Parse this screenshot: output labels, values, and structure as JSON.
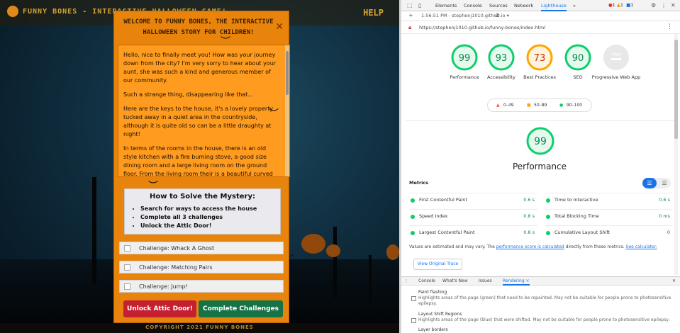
{
  "game": {
    "brand": "FUNNY BONES - INTERACTIVE HALLOWEEN GAME!",
    "help": "HELP",
    "footer": "COPYRIGHT 2021 FUNNY BONES",
    "modal": {
      "title": "WELCOME TO FUNNY BONES, THE INTERACTIVE HALLOWEEN STORY FOR CHILDREN!",
      "close_icon": "close-icon",
      "story": [
        "Hello, nice to finally meet you! How was your journey down from the city? I'm very sorry to hear about your aunt, she was such a kind and generous member of our community.",
        "Such a strange thing, disappearing like that...",
        "Here are the keys to the house, it's a lovely property tucked away in a quiet area in the countryside, although it is quite old so can be a little draughty at night!",
        "In terms of the rooms in the house, there is an old style kitchen with a fire burning stove, a good size dining room and a large living room on the ground floor. From the living room their is a beautiful curved staircase leading to the first floor where you will find two bedrooms and a"
      ],
      "howto_title": "How to Solve the Mystery:",
      "howto_items": [
        "Search for ways to access the house",
        "Complete all 3 challenges",
        "Unlock the Attic Door!"
      ],
      "challenges": [
        "Challenge: Whack A Ghost",
        "Challenge: Matching Pairs",
        "Challenge: Jump!"
      ],
      "unlock_button": "Unlock Attic Door!",
      "complete_button": "Complete Challenges"
    }
  },
  "devtools": {
    "tabs": [
      "Elements",
      "Console",
      "Sources",
      "Network",
      "Lighthouse",
      "»"
    ],
    "active_tab": "Lighthouse",
    "badges": {
      "errors": "1",
      "warnings": "1",
      "info": "1"
    },
    "report_select": "1:56:51 PM - stephenj1010.github.io ▾",
    "url": "https://stephenj1010.github.io/funny-bones/index.html",
    "scores": [
      {
        "label": "Performance",
        "value": "99",
        "color": "#0cce6b"
      },
      {
        "label": "Accessibility",
        "value": "93",
        "color": "#0cce6b"
      },
      {
        "label": "Best Practices",
        "value": "73",
        "color": "#ffa400"
      },
      {
        "label": "SEO",
        "value": "90",
        "color": "#0cce6b"
      },
      {
        "label": "Progressive Web App",
        "value": "PWA",
        "color": "#c4c4c4"
      }
    ],
    "legend": {
      "fail": "0–49",
      "average": "50–89",
      "pass": "90–100"
    },
    "main_score": "99",
    "main_title": "Performance",
    "metrics_header": "Metrics",
    "metrics": [
      {
        "name": "First Contentful Paint",
        "value": "0.6 s"
      },
      {
        "name": "Time to Interactive",
        "value": "0.6 s"
      },
      {
        "name": "Speed Index",
        "value": "0.8 s"
      },
      {
        "name": "Total Blocking Time",
        "value": "0 ms"
      },
      {
        "name": "Largest Contentful Paint",
        "value": "0.8 s"
      },
      {
        "name": "Cumulative Layout Shift",
        "value": "0"
      }
    ],
    "note_prefix": "Values are estimated and may vary. The",
    "note_link": "performance score is calculated",
    "note_mid": "directly from these metrics.",
    "note_link2": "See calculator.",
    "trace_button": "View Original Trace",
    "drawer_tabs": [
      "Console",
      "What's New",
      "Issues",
      "Rendering ×"
    ],
    "rendering": [
      {
        "title": "Paint flashing",
        "desc": "Highlights areas of the page (green) that need to be repainted. May not be suitable for people prone to photosensitive epilepsy."
      },
      {
        "title": "Layout Shift Regions",
        "desc": "Highlights areas of the page (blue) that were shifted. May not be suitable for people prone to photosensitive epilepsy."
      },
      {
        "title": "Layer borders",
        "desc": ""
      }
    ]
  }
}
